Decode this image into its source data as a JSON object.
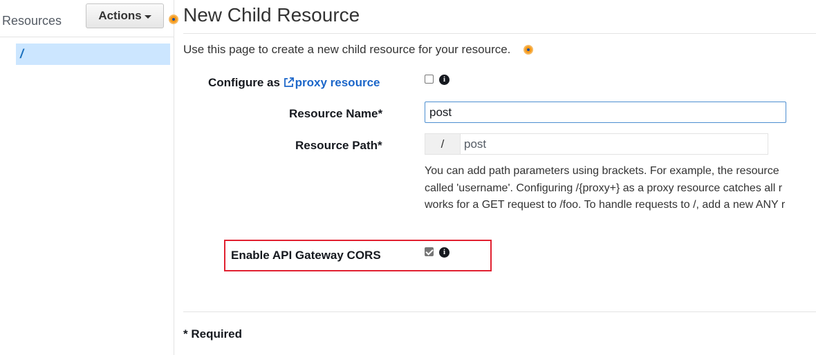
{
  "sidebar": {
    "title": "Resources",
    "actions_label": "Actions",
    "tree": [
      {
        "label": "/"
      }
    ]
  },
  "main": {
    "title": "New Child Resource",
    "description": "Use this page to create a new child resource for your resource.",
    "form": {
      "proxy": {
        "prefix": "Configure as",
        "link": "proxy resource",
        "checked": false
      },
      "resource_name": {
        "label": "Resource Name*",
        "value": "post"
      },
      "resource_path": {
        "label": "Resource Path*",
        "prefix": "/",
        "value": "post"
      },
      "help_lines": [
        "You can add path parameters using brackets. For example, the resource",
        "called 'username'. Configuring /{proxy+} as a proxy resource catches all r",
        "works for a GET request to /foo. To handle requests to /, add a new ANY r"
      ],
      "cors": {
        "label": "Enable API Gateway CORS",
        "checked": true
      }
    },
    "required_note": "* Required"
  },
  "colors": {
    "accent": "#1b66c9",
    "selected_bg": "#cce6ff",
    "highlight": "#e12030",
    "beacon": "#f79a1a"
  }
}
